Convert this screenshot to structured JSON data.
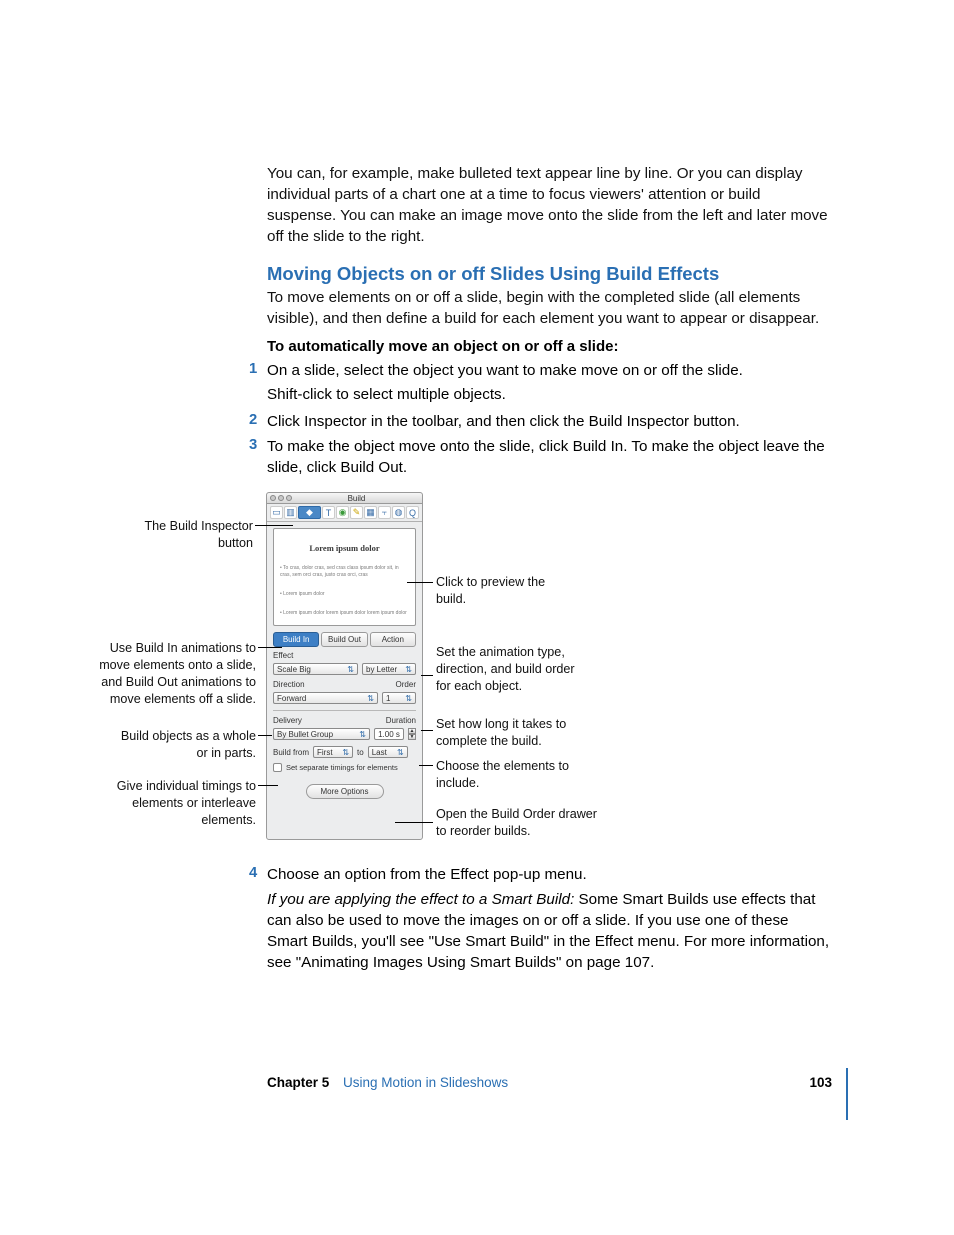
{
  "intro": "You can, for example, make bulleted text appear line by line. Or you can display individual parts of a chart one at a time to focus viewers' attention or build suspense. You can make an image move onto the slide from the left and later move off the slide to the right.",
  "h2": "Moving Objects on or off Slides Using Build Effects",
  "h2_body": "To move elements on or off a slide, begin with the completed slide (all elements visible), and then define a build for each element you want to appear or disappear.",
  "bold_lead": "To automatically move an object on or off a slide:",
  "steps": {
    "n1": "1",
    "t1": "On a slide, select the object you want to make move on or off the slide.",
    "t1b": "Shift-click to select multiple objects.",
    "n2": "2",
    "t2": "Click Inspector in the toolbar, and then click the Build Inspector button.",
    "n3": "3",
    "t3": "To make the object move onto the slide, click Build In. To make the object leave the slide, click Build Out.",
    "n4": "4",
    "t4": "Choose an option from the Effect pop-up menu.",
    "t4p_i": "If you are applying the effect to a Smart Build:",
    "t4p": "  Some Smart Builds use effects that can also be used to move the images on or off a slide. If you use one of these Smart Builds, you'll see \"Use Smart Build\" in the Effect menu. For more information, see \"Animating Images Using Smart Builds\" on page 107."
  },
  "panel": {
    "title": "Build",
    "preview_headline": "Lorem ipsum dolor",
    "tabs": {
      "build_in": "Build In",
      "build_out": "Build Out",
      "action": "Action"
    },
    "labels": {
      "effect": "Effect",
      "direction": "Direction",
      "order": "Order",
      "delivery": "Delivery",
      "duration": "Duration",
      "build_from": "Build from",
      "to": "to",
      "set_separate": "Set separate timings for elements"
    },
    "values": {
      "effect": "Scale Big",
      "delivery_mode": "by Letter",
      "direction": "Forward",
      "order": "1",
      "delivery": "By Bullet Group",
      "duration": "1.00 s",
      "from": "First",
      "to": "Last",
      "more": "More Options"
    }
  },
  "callouts": {
    "c_inspector": "The Build Inspector button",
    "c_buildin": "Use Build In animations to move elements onto a slide, and Build Out animations to move elements off a slide.",
    "c_parts": "Build objects as a whole or in parts.",
    "c_timings": "Give individual timings to elements or interleave elements.",
    "c_preview": "Click to preview the build.",
    "c_type": "Set the animation type, direction, and build order for each object.",
    "c_duration": "Set how long it takes to complete the build.",
    "c_include": "Choose the elements to include.",
    "c_drawer": "Open the Build Order drawer to reorder builds."
  },
  "footer": {
    "chapter": "Chapter 5",
    "name": "Using Motion in Slideshows",
    "page": "103"
  }
}
